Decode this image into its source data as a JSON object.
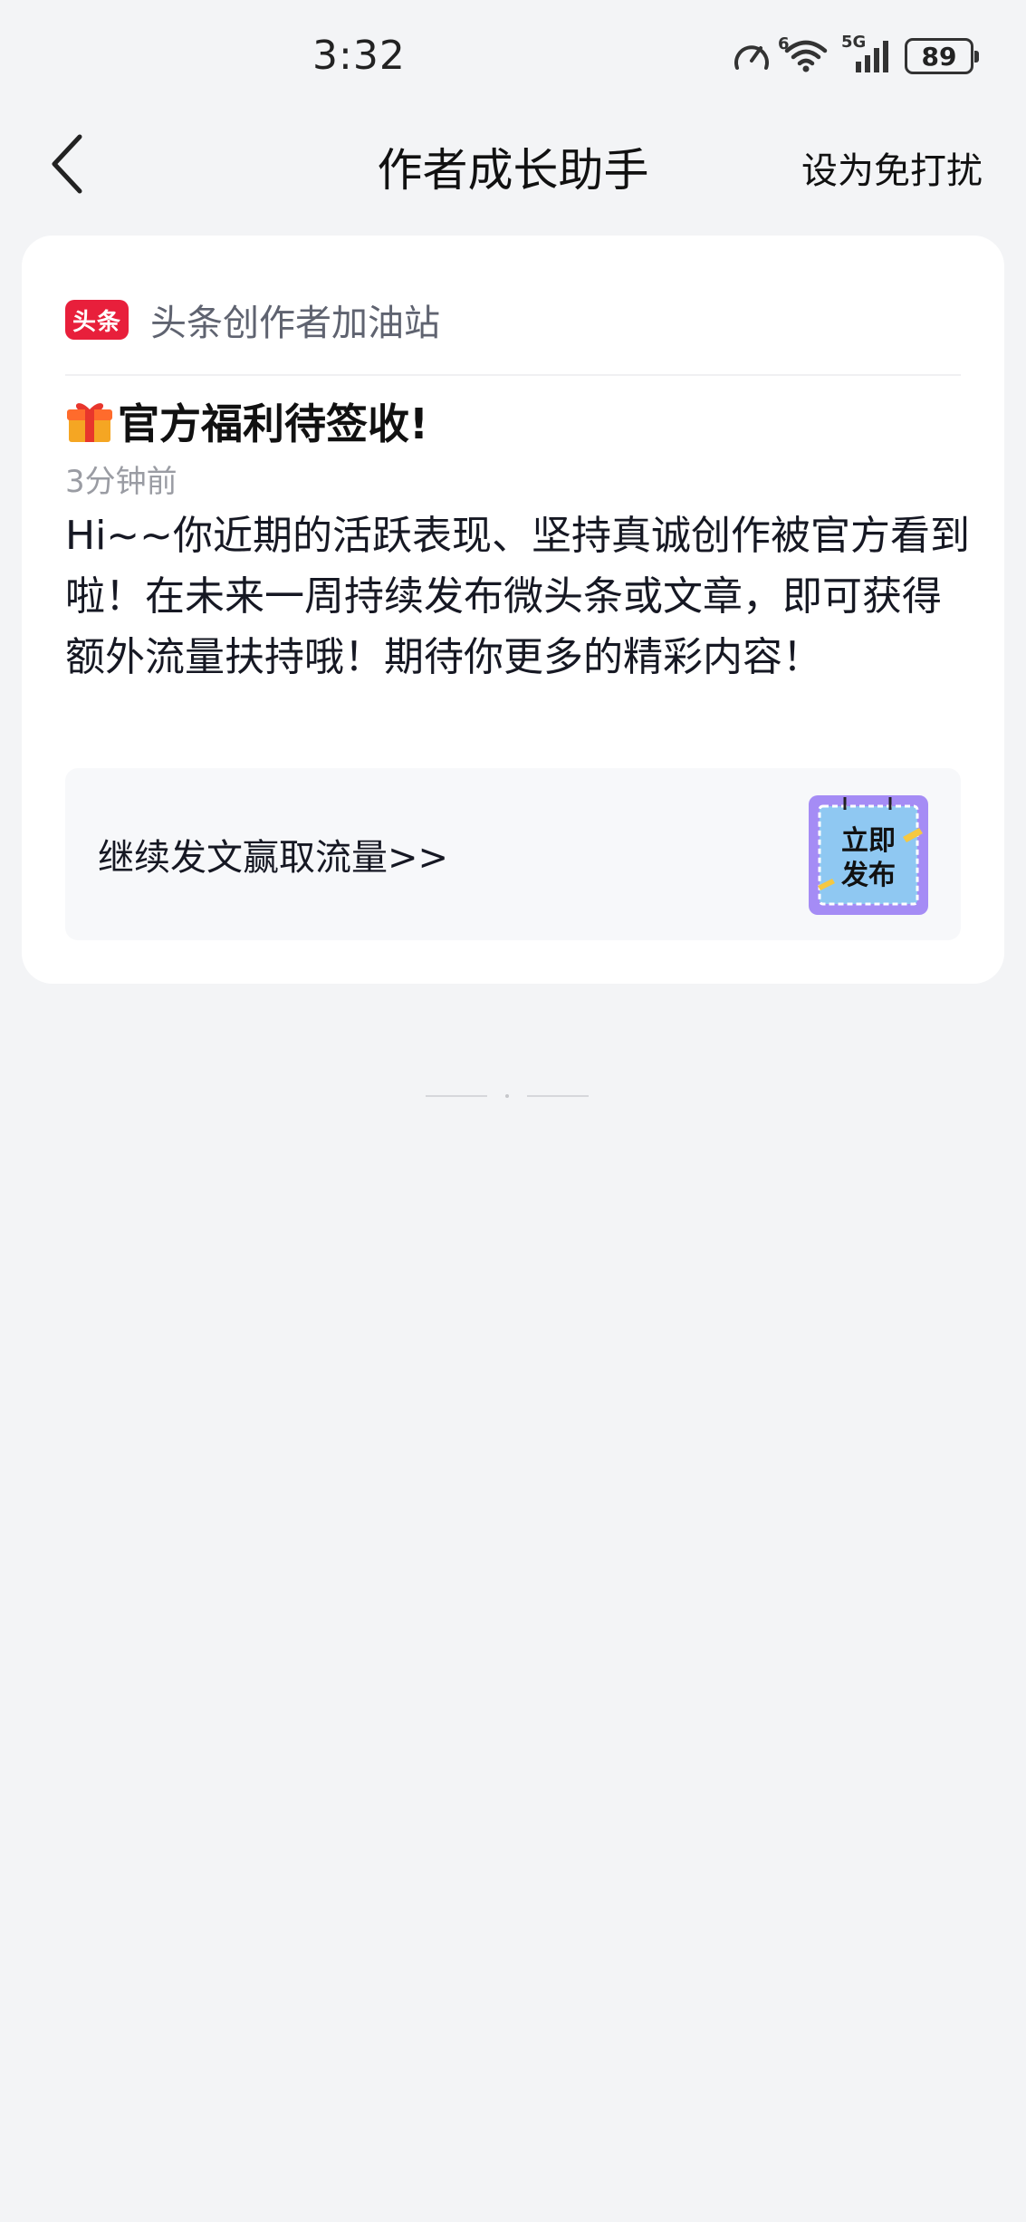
{
  "status_bar": {
    "time": "3:32",
    "network": "5G",
    "wifi_badge": "6",
    "battery": "89",
    "icons": [
      "speed-icon",
      "wifi-icon",
      "cellular-signal-icon",
      "battery-icon"
    ]
  },
  "nav": {
    "title": "作者成长助手",
    "action": "设为免打扰",
    "back_icon": "chevron-left-icon"
  },
  "card": {
    "logo_text": "头条",
    "source": "头条创作者加油站",
    "title": "官方福利待签收!",
    "time": "3分钟前",
    "body": "Hi~~你近期的活跃表现、坚持真诚创作被官方看到啦！在未来一周持续发布微头条或文章，即可获得额外流量扶持哦！期待你更多的精彩内容！",
    "cta_label": "继续发文赢取流量>>",
    "cta_badge": "立即发布",
    "colors": {
      "logo_red": "#e81f3b",
      "badge_purple": "#a58cf5",
      "badge_blue": "#8fc8f2"
    }
  }
}
